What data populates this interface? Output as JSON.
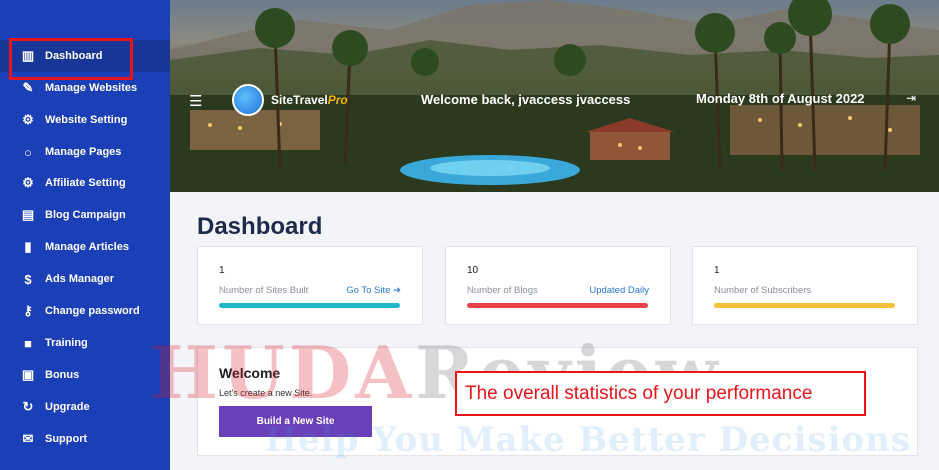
{
  "sidebar": {
    "items": [
      {
        "label": "Dashboard",
        "icon": "dashboard-icon",
        "glyph": "▥"
      },
      {
        "label": "Manage Websites",
        "icon": "magic-wand-icon",
        "glyph": "✎"
      },
      {
        "label": "Website Setting",
        "icon": "gears-icon",
        "glyph": "⚙"
      },
      {
        "label": "Manage Pages",
        "icon": "circle-icon",
        "glyph": "○"
      },
      {
        "label": "Affiliate Setting",
        "icon": "gear-icon",
        "glyph": "⚙"
      },
      {
        "label": "Blog Campaign",
        "icon": "newspaper-icon",
        "glyph": "▤"
      },
      {
        "label": "Manage Articles",
        "icon": "file-icon",
        "glyph": "▮"
      },
      {
        "label": "Ads Manager",
        "icon": "dollar-icon",
        "glyph": "$"
      },
      {
        "label": "Change password",
        "icon": "key-icon",
        "glyph": "⚷"
      },
      {
        "label": "Training",
        "icon": "video-icon",
        "glyph": "■"
      },
      {
        "label": "Bonus",
        "icon": "gift-icon",
        "glyph": "▣"
      },
      {
        "label": "Upgrade",
        "icon": "sync-icon",
        "glyph": "↻"
      },
      {
        "label": "Support",
        "icon": "envelope-icon",
        "glyph": "✉"
      }
    ]
  },
  "header": {
    "menu_glyph": "☰",
    "logo_text": "SiteTravel",
    "logo_pro": "Pro",
    "welcome": "Welcome back, jvaccess jvaccess",
    "date": "Monday 8th of August 2022",
    "logout_glyph": "⇥"
  },
  "main": {
    "title": "Dashboard",
    "stats": [
      {
        "value": "1",
        "label": "Number of Sites Built",
        "link": "Go To Site ➔",
        "color": "#1fb8c8"
      },
      {
        "value": "10",
        "label": "Number of Blogs",
        "link": "Updated Daily",
        "color": "#e8414a"
      },
      {
        "value": "1",
        "label": "Number of Subscribers",
        "link": "",
        "color": "#f5c03a"
      }
    ],
    "welcome": {
      "title": "Welcome",
      "subtitle": "Let's create a new Site.",
      "button": "Build a New Site"
    }
  },
  "overlay": {
    "watermark_red": "HUDA",
    "watermark_grey": "Review",
    "watermark_tagline": "Help You Make Better Decisions",
    "annotation": "The overall statistics of your performance"
  }
}
